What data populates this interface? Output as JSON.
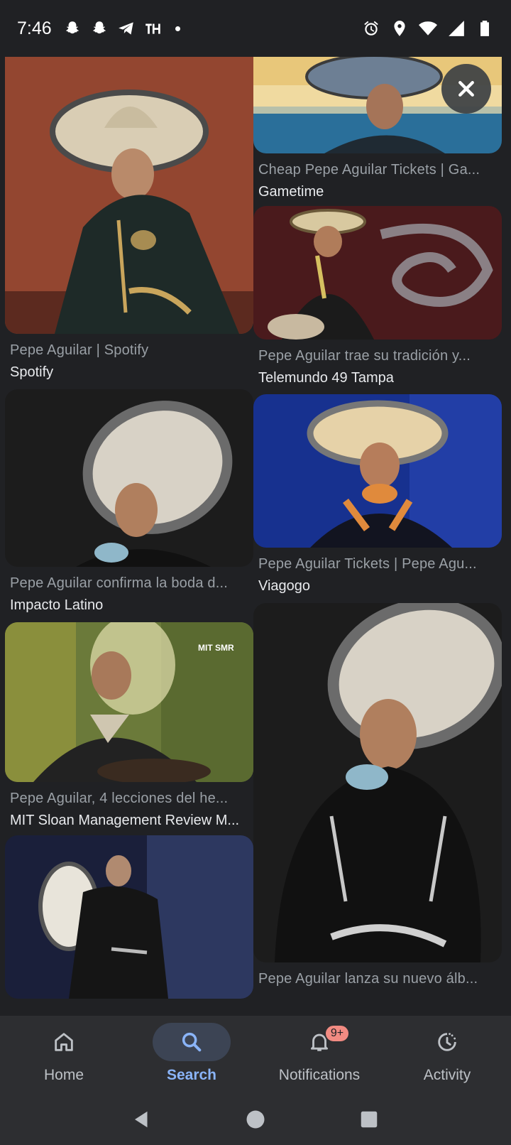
{
  "status_bar": {
    "time": "7:46",
    "left_icons": [
      "snapchat-icon",
      "snapchat-icon",
      "telegram-icon",
      "th-icon",
      "dot"
    ],
    "right_icons": [
      "alarm-icon",
      "location-icon",
      "wifi-icon",
      "signal-icon",
      "battery-icon"
    ]
  },
  "results": {
    "left": [
      {
        "title": "Pepe Aguilar | Spotify",
        "source": "Spotify"
      },
      {
        "title": "Pepe Aguilar confirma la boda d...",
        "source": "Impacto Latino"
      },
      {
        "title": "Pepe Aguilar, 4 lecciones del he...",
        "source": "MIT Sloan Management Review M..."
      },
      {
        "title": "",
        "source": ""
      }
    ],
    "right": [
      {
        "title": "Cheap Pepe Aguilar Tickets | Ga...",
        "source": "Gametime"
      },
      {
        "title": "Pepe Aguilar trae su tradición y...",
        "source": "Telemundo 49 Tampa"
      },
      {
        "title": "Pepe Aguilar Tickets | Pepe Agu...",
        "source": "Viagogo"
      },
      {
        "title": "Pepe Aguilar lanza su nuevo álb...",
        "source": ""
      }
    ],
    "image_watermark": "MIT SMR"
  },
  "bottom_nav": {
    "items": [
      {
        "label": "Home",
        "icon": "home-icon"
      },
      {
        "label": "Search",
        "icon": "search-icon",
        "active": true
      },
      {
        "label": "Notifications",
        "icon": "bell-icon",
        "badge": "9+"
      },
      {
        "label": "Activity",
        "icon": "activity-icon"
      }
    ]
  },
  "colors": {
    "background": "#202124",
    "nav_background": "#2d2e31",
    "active_accent": "#8ab4f8",
    "badge": "#f28b82"
  }
}
